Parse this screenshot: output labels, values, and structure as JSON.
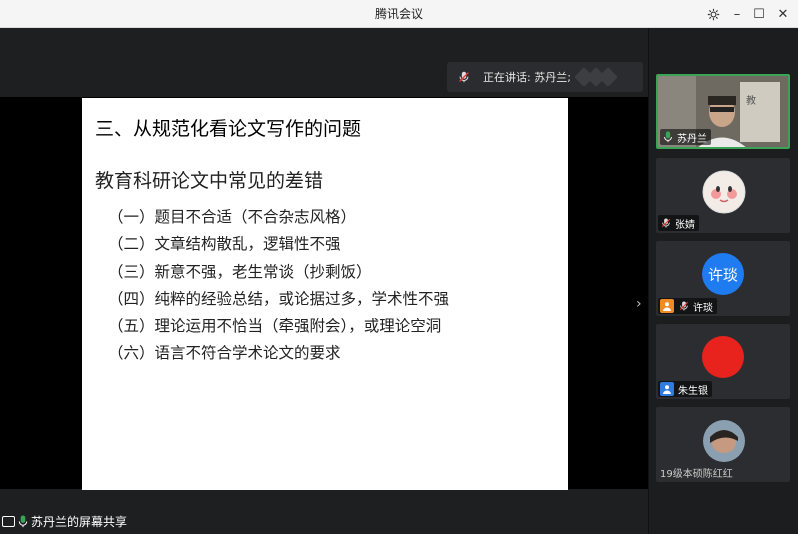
{
  "window": {
    "title": "腾讯会议",
    "controls": {
      "settings_icon": "gear-icon",
      "minimize": "–",
      "maximize": "☐",
      "close": "✕"
    }
  },
  "speaking": {
    "label": "正在讲话: 苏丹兰;"
  },
  "slide": {
    "heading": "三、从规范化看论文写作的问题",
    "subheading": "教育科研论文中常见的差错",
    "items": [
      "（一）题目不合适（不合杂志风格）",
      "（二）文章结构散乱，逻辑性不强",
      "（三）新意不强，老生常谈（抄剩饭）",
      "（四）纯粹的经验总结，或论据过多，学术性不强",
      "（五）理论运用不恰当（牵强附会），或理论空洞",
      "（六）语言不符合学术论文的要求"
    ]
  },
  "share_status": {
    "text": "苏丹兰的屏幕共享"
  },
  "participants": [
    {
      "name": "苏丹兰",
      "active": true,
      "mic": "on"
    },
    {
      "name": "张婧",
      "mic": "muted"
    },
    {
      "name": "许琰",
      "avatar_text": "许琰",
      "avatar_color": "#1e7bf0",
      "mic": "muted"
    },
    {
      "name": "朱生银",
      "avatar_color": "#e8231d"
    },
    {
      "name": "19级本硕陈红红"
    }
  ],
  "colors": {
    "accent_green": "#3aa356",
    "titlebar": "#f5f5f5",
    "slide_bg": "#ffffff"
  }
}
